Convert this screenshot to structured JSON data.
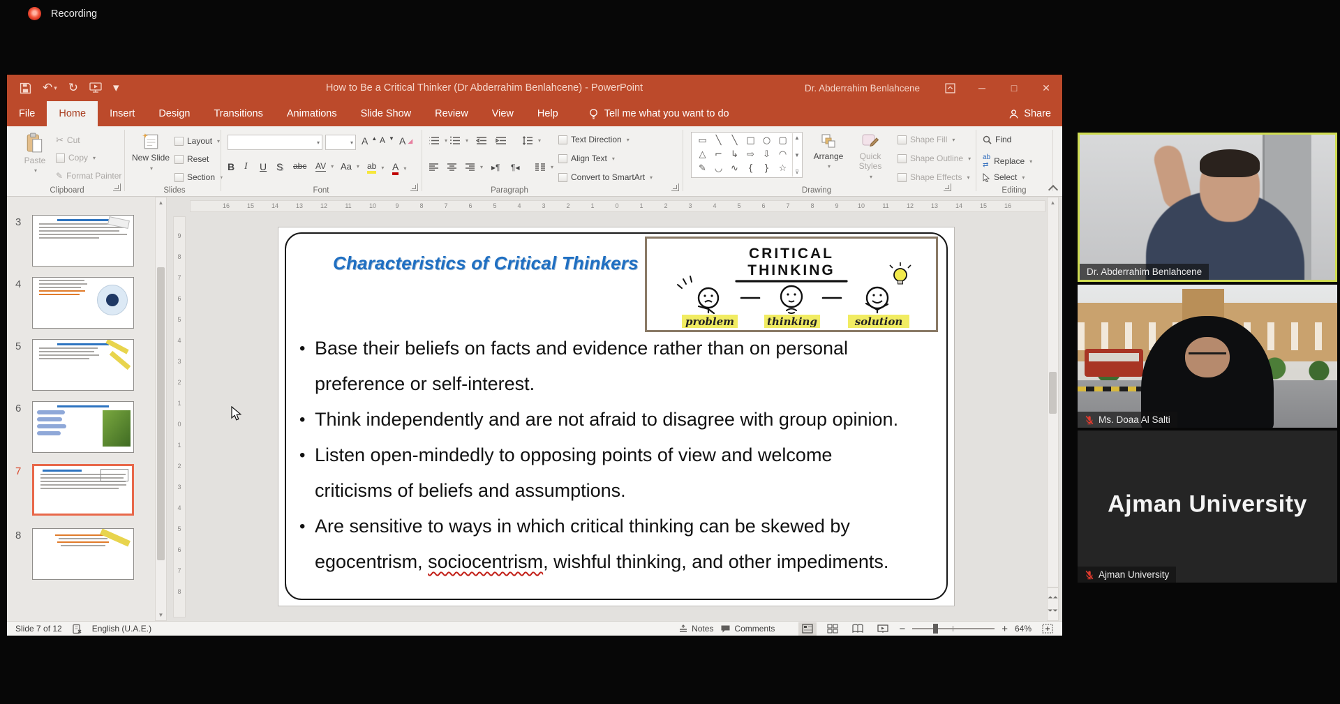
{
  "recording": {
    "label": "Recording"
  },
  "titlebar": {
    "title": "How to Be a Critical Thinker (Dr Abderrahim Benlahcene)  -  PowerPoint",
    "user": "Dr. Abderrahim Benlahcene"
  },
  "tabs": {
    "items": [
      "File",
      "Home",
      "Insert",
      "Design",
      "Transitions",
      "Animations",
      "Slide Show",
      "Review",
      "View",
      "Help"
    ],
    "selected": "Home",
    "tell_me": "Tell me what you want to do",
    "share": "Share"
  },
  "ribbon": {
    "clipboard": {
      "group": "Clipboard",
      "paste": "Paste",
      "cut": "Cut",
      "copy": "Copy",
      "format_painter": "Format Painter"
    },
    "slides": {
      "group": "Slides",
      "new_slide": "New Slide",
      "layout": "Layout",
      "reset": "Reset",
      "section": "Section"
    },
    "font": {
      "group": "Font",
      "b": "B",
      "i": "I",
      "u": "U",
      "s": "S",
      "abc": "abc",
      "av": "AV",
      "aa": "Aa",
      "grow": "A",
      "shrink": "A",
      "clear": "A",
      "color": "A",
      "highlight": "ab"
    },
    "paragraph": {
      "group": "Paragraph",
      "text_direction": "Text Direction",
      "align_text": "Align Text",
      "convert": "Convert to SmartArt"
    },
    "drawing": {
      "group": "Drawing",
      "arrange": "Arrange",
      "quick_styles": "Quick Styles",
      "shape_fill": "Shape Fill",
      "shape_outline": "Shape Outline",
      "shape_effects": "Shape Effects",
      "shapes": [
        "▭",
        "╲",
        "╲",
        "□",
        "○",
        "▢",
        "△",
        "⌐",
        "↳",
        "⇨",
        "⇩",
        "◠",
        "✎",
        "◡",
        "∿",
        "{",
        "}",
        "☆"
      ]
    },
    "editing": {
      "group": "Editing",
      "find": "Find",
      "replace": "Replace",
      "select": "Select"
    }
  },
  "thumbnails": {
    "selected": "7",
    "items": [
      {
        "n": "3"
      },
      {
        "n": "4"
      },
      {
        "n": "5"
      },
      {
        "n": "6"
      },
      {
        "n": "7"
      },
      {
        "n": "8"
      }
    ]
  },
  "rulers": {
    "h": [
      16,
      15,
      14,
      13,
      12,
      11,
      10,
      9,
      8,
      7,
      6,
      5,
      4,
      3,
      2,
      1,
      0,
      1,
      2,
      3,
      4,
      5,
      6,
      7,
      8,
      9,
      10,
      11,
      12,
      13,
      14,
      15,
      16
    ],
    "v": [
      9,
      8,
      7,
      6,
      5,
      4,
      3,
      2,
      1,
      0,
      1,
      2,
      3,
      4,
      5,
      6,
      7,
      8
    ]
  },
  "slide": {
    "title": "Characteristics of Critical Thinkers",
    "bullets": [
      {
        "lines": [
          [
            "Base their beliefs on facts and evidence rather than on personal"
          ],
          [
            "preference or self-interest."
          ]
        ]
      },
      {
        "lines": [
          [
            "Think independently and are not afraid to disagree with group opinion."
          ]
        ]
      },
      {
        "lines": [
          [
            "Listen open-mindedly to opposing points of view and welcome"
          ],
          [
            "criticisms of beliefs and assumptions."
          ]
        ]
      },
      {
        "lines": [
          [
            "Are sensitive to ways in which critical thinking can be skewed by"
          ],
          [
            "egocentrism, ",
            {
              "sq": "sociocentrism"
            },
            ", wishful thinking, and other impediments."
          ]
        ]
      }
    ],
    "figure": {
      "line1": "CRITICAL",
      "line2": "THINKING",
      "labels": [
        "problem",
        "thinking",
        "solution"
      ]
    }
  },
  "statusbar": {
    "slide_indicator": "Slide 7 of 12",
    "language": "English (U.A.E.)",
    "notes": "Notes",
    "comments": "Comments",
    "zoom_level": "64%"
  },
  "panel": {
    "tiles": [
      {
        "name": "Dr. Abderrahim Benlahcene",
        "muted": false,
        "active": true
      },
      {
        "name": "Ms. Doaa Al Salti",
        "muted": true
      },
      {
        "name": "Ajman University",
        "muted": true,
        "display": "Ajman University"
      }
    ]
  },
  "colors": {
    "accent": "#BC4A2B",
    "active_border": "#CFDC52",
    "title_blue": "#1F6FC2",
    "mic_red": "#E23B2E",
    "selection": "#E8684A"
  }
}
